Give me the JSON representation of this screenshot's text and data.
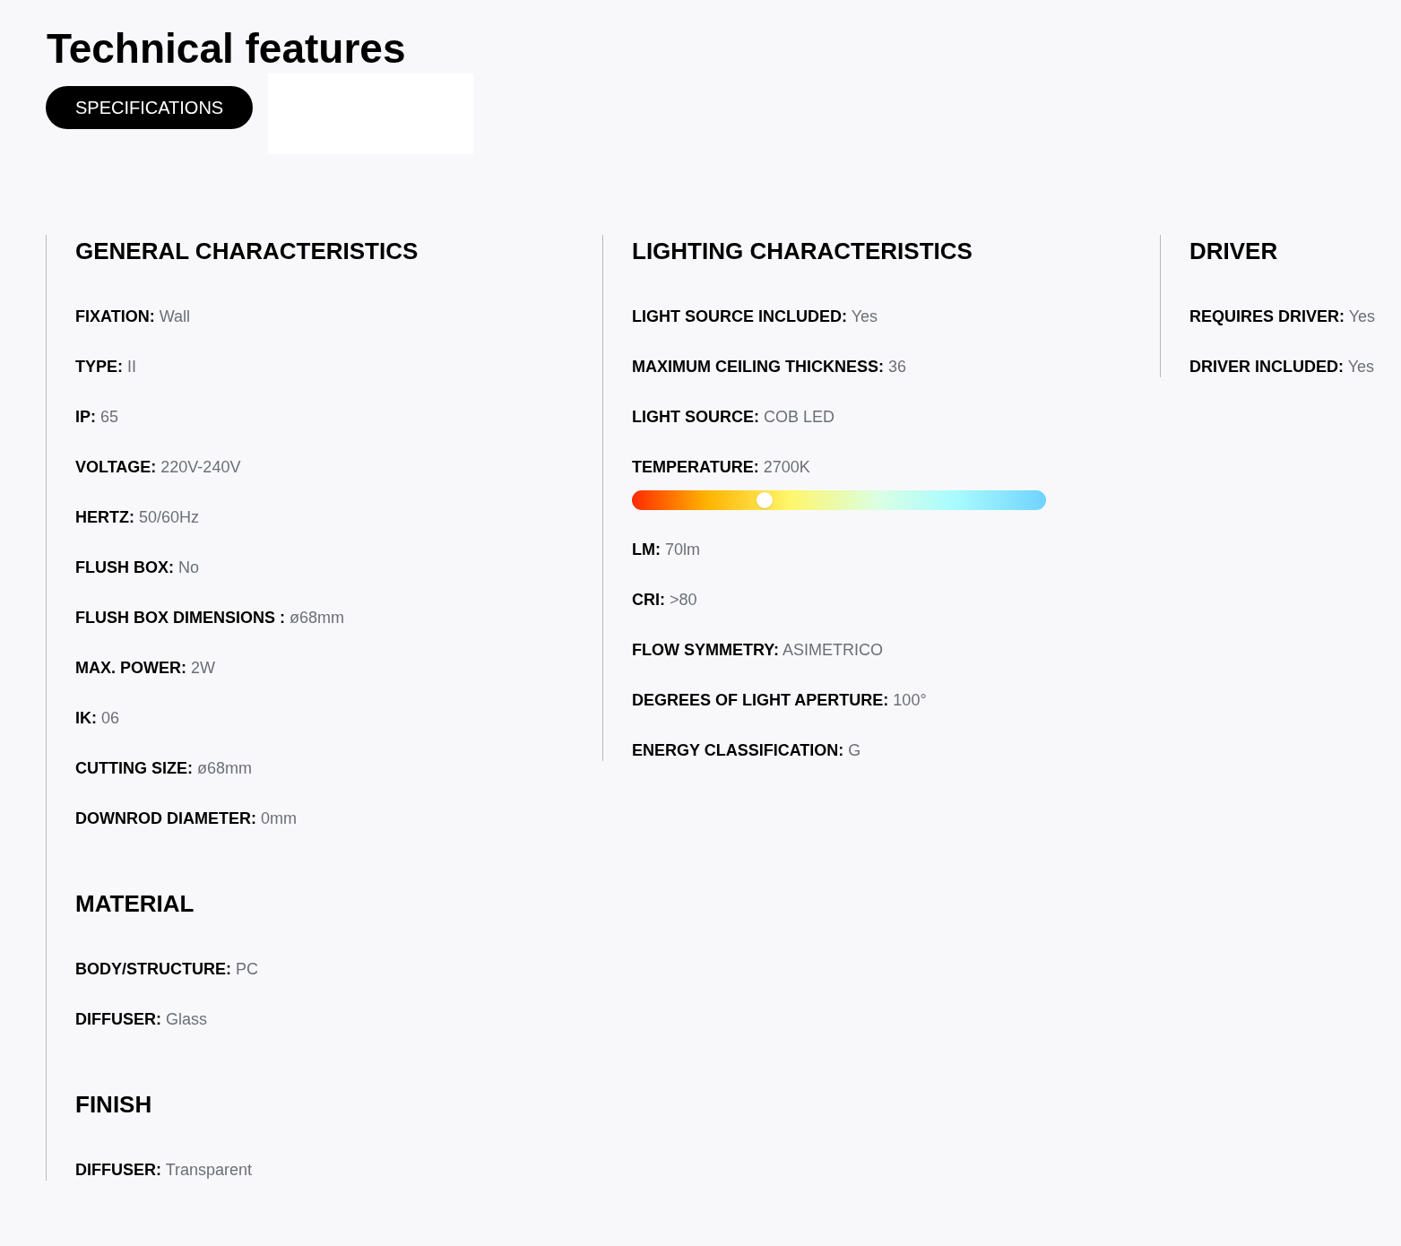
{
  "title": "Technical features",
  "tabs": [
    {
      "label": "SPECIFICATIONS",
      "selected": true
    }
  ],
  "columns": [
    {
      "sections": [
        {
          "heading": "GENERAL CHARACTERISTICS",
          "items": [
            {
              "kind": "text",
              "label": "FIXATION:",
              "value": "Wall"
            },
            {
              "kind": "text",
              "label": "TYPE:",
              "value": "II"
            },
            {
              "kind": "text",
              "label": "IP:",
              "value": "65"
            },
            {
              "kind": "text",
              "label": "VOLTAGE:",
              "value": "220V-240V"
            },
            {
              "kind": "text",
              "label": "HERTZ:",
              "value": "50/60Hz"
            },
            {
              "kind": "text",
              "label": "FLUSH BOX:",
              "value": "No"
            },
            {
              "kind": "text",
              "label": "FLUSH BOX DIMENSIONS :",
              "value": "ø68mm"
            },
            {
              "kind": "text",
              "label": "MAX. POWER:",
              "value": "2W"
            },
            {
              "kind": "text",
              "label": "IK:",
              "value": "06"
            },
            {
              "kind": "text",
              "label": "CUTTING SIZE:",
              "value": "ø68mm"
            },
            {
              "kind": "text",
              "label": "DOWNROD DIAMETER:",
              "value": "0mm"
            }
          ]
        },
        {
          "heading": "MATERIAL",
          "items": [
            {
              "kind": "text",
              "label": "BODY/STRUCTURE:",
              "value": "PC"
            },
            {
              "kind": "text",
              "label": "DIFFUSER:",
              "value": "Glass"
            }
          ]
        },
        {
          "heading": "FINISH",
          "items": [
            {
              "kind": "text",
              "label": "DIFFUSER:",
              "value": "Transparent"
            }
          ]
        }
      ]
    },
    {
      "sections": [
        {
          "heading": "LIGHTING CHARACTERISTICS",
          "items": [
            {
              "kind": "text",
              "label": "LIGHT SOURCE INCLUDED:",
              "value": "Yes"
            },
            {
              "kind": "text",
              "label": "MAXIMUM CEILING THICKNESS:",
              "value": "36"
            },
            {
              "kind": "text",
              "label": "LIGHT SOURCE:",
              "value": "COB LED"
            },
            {
              "kind": "temperature",
              "label": "TEMPERATURE:",
              "value": "2700K",
              "level": 0.32
            },
            {
              "kind": "text",
              "label": "LM:",
              "value": "70lm"
            },
            {
              "kind": "text",
              "label": "CRI:",
              "value": ">80"
            },
            {
              "kind": "text",
              "label": "FLOW SYMMETRY:",
              "value": "ASIMETRICO"
            },
            {
              "kind": "text",
              "label": "DEGREES OF LIGHT APERTURE:",
              "value": "100°"
            },
            {
              "kind": "text",
              "label": "ENERGY CLASSIFICATION:",
              "value": "G"
            }
          ]
        }
      ]
    },
    {
      "sections": [
        {
          "heading": "DRIVER",
          "items": [
            {
              "kind": "text",
              "label": "REQUIRES DRIVER:",
              "value": "Yes"
            },
            {
              "kind": "text",
              "label": "DRIVER INCLUDED:",
              "value": "Yes"
            }
          ]
        }
      ]
    }
  ]
}
